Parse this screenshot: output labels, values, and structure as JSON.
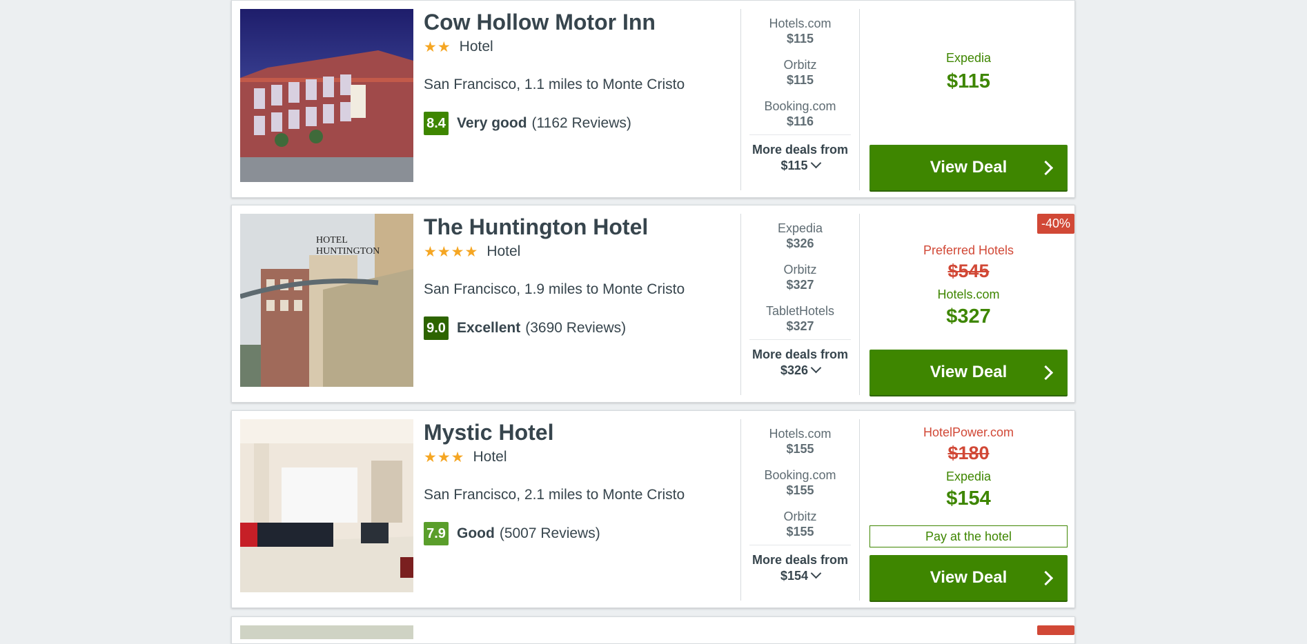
{
  "hotels": [
    {
      "name": "Cow Hollow Motor Inn",
      "stars": "★★",
      "star_count": 2,
      "type": "Hotel",
      "location": "San Francisco, 1.1 miles to Monte Cristo",
      "score": "8.4",
      "score_color": "#3e8600",
      "rating_label": "Very good",
      "reviews": "(1162 Reviews)",
      "alt_deals": [
        {
          "provider": "Hotels.com",
          "price": "$115"
        },
        {
          "provider": "Orbitz",
          "price": "$115"
        },
        {
          "provider": "Booking.com",
          "price": "$116"
        }
      ],
      "more_deals_label": "More deals from",
      "more_deals_price": "$115",
      "main_provider": "Expedia",
      "main_price": "$115",
      "view_deal": "View Deal"
    },
    {
      "name": "The Huntington Hotel",
      "stars": "★★★★",
      "star_count": 4,
      "type": "Hotel",
      "location": "San Francisco, 1.9 miles to Monte Cristo",
      "score": "9.0",
      "score_color": "#2d6400",
      "rating_label": "Excellent",
      "reviews": "(3690 Reviews)",
      "discount": "-40%",
      "alt_deals": [
        {
          "provider": "Expedia",
          "price": "$326"
        },
        {
          "provider": "Orbitz",
          "price": "$327"
        },
        {
          "provider": "TabletHotels",
          "price": "$327"
        }
      ],
      "more_deals_label": "More deals from",
      "more_deals_price": "$326",
      "old_provider": "Preferred Hotels",
      "old_price": "$545",
      "main_provider": "Hotels.com",
      "main_price": "$327",
      "view_deal": "View Deal"
    },
    {
      "name": "Mystic Hotel",
      "stars": "★★★",
      "star_count": 3,
      "type": "Hotel",
      "location": "San Francisco, 2.1 miles to Monte Cristo",
      "score": "7.9",
      "score_color": "#5a9e2b",
      "rating_label": "Good",
      "reviews": "(5007 Reviews)",
      "alt_deals": [
        {
          "provider": "Hotels.com",
          "price": "$155"
        },
        {
          "provider": "Booking.com",
          "price": "$155"
        },
        {
          "provider": "Orbitz",
          "price": "$155"
        }
      ],
      "more_deals_label": "More deals from",
      "more_deals_price": "$154",
      "old_provider": "HotelPower.com",
      "old_price": "$180",
      "main_provider": "Expedia",
      "main_price": "$154",
      "pay_at_hotel": "Pay at the hotel",
      "view_deal": "View Deal"
    }
  ],
  "colors": {
    "accent_green": "#3e8600",
    "discount_red": "#d14836",
    "star": "#f5a623"
  }
}
